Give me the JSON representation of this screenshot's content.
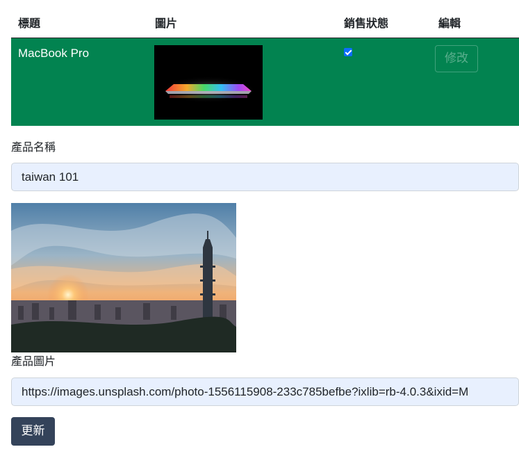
{
  "table": {
    "headers": {
      "title": "標題",
      "image": "圖片",
      "status": "銷售狀態",
      "edit": "編輯"
    },
    "rows": [
      {
        "title": "MacBook Pro",
        "status_checked": true,
        "edit_label": "修改"
      }
    ],
    "row_bg_color": "#028350"
  },
  "form": {
    "name_label": "產品名稱",
    "name_value": "taiwan 101",
    "image_label": "產品圖片",
    "image_url_value": "https://images.unsplash.com/photo-1556115908-233c785befbe?ixlib=rb-4.0.3&ixid=M",
    "input_bg_color": "#e8f0fe",
    "update_label": "更新",
    "update_button_color": "#34435a"
  }
}
